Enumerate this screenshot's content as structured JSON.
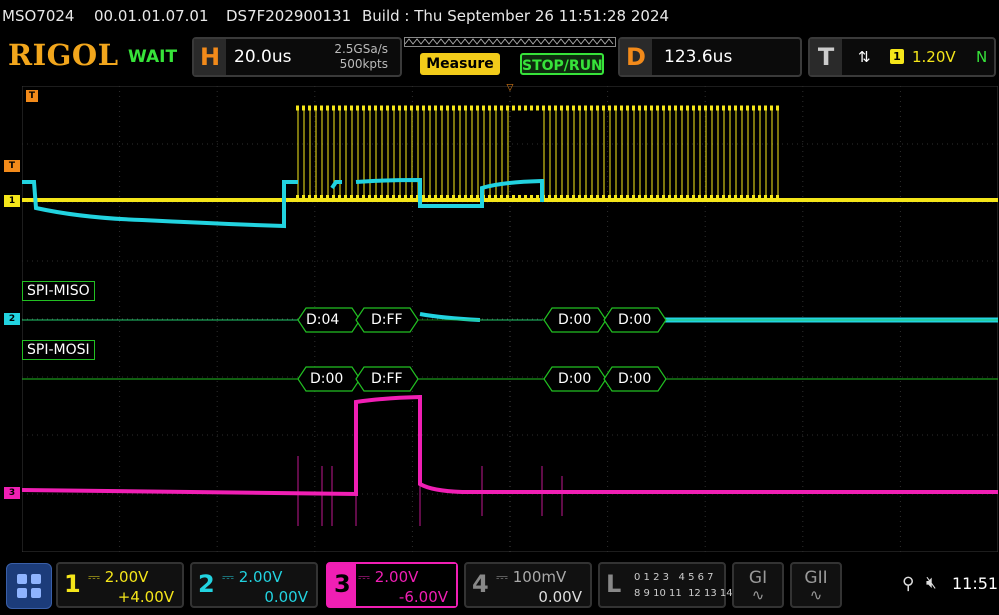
{
  "top_info": {
    "model": "MSO7024",
    "firmware": "00.01.01.07.01",
    "serial": "DS7F202900131",
    "build": "Build : Thu September 26 11:51:28 2024"
  },
  "toolbar": {
    "logo": "RIGOL",
    "status": "WAIT",
    "horizontal": {
      "badge": "H",
      "timebase": "20.0us",
      "sample_rate": "2.5GSa/s",
      "memory": "500kpts"
    },
    "measure_label": "Measure",
    "stop_run_label": "STOP/RUN",
    "delay": {
      "badge": "D",
      "value": "123.6us"
    },
    "trigger": {
      "badge": "T",
      "edge": "⇅",
      "source": "1",
      "level": "1.20V",
      "mode": "N"
    }
  },
  "markers": {
    "trigger_pos": "T",
    "trigger_level": "T",
    "ch1": "1",
    "ch2": "2",
    "ch3": "3"
  },
  "decoders": {
    "miso": {
      "label": "SPI-MISO",
      "packets": [
        "D:04",
        "D:FF",
        "D:00",
        "D:00"
      ]
    },
    "mosi": {
      "label": "SPI-MOSI",
      "packets": [
        "D:00",
        "D:FF",
        "D:00",
        "D:00"
      ]
    }
  },
  "channels": [
    {
      "num": "1",
      "scale": "2.00V",
      "offset": "+4.00V",
      "color": "#f5e61a"
    },
    {
      "num": "2",
      "scale": "2.00V",
      "offset": "0.00V",
      "color": "#22d3e0"
    },
    {
      "num": "3",
      "scale": "2.00V",
      "offset": "-6.00V",
      "color": "#f01fb4"
    },
    {
      "num": "4",
      "scale": "100mV",
      "offset": "0.00V",
      "color": "#777777"
    }
  ],
  "logic": {
    "badge": "L",
    "row1": "0 1 2 3   4 5 6 7",
    "row2": "8 9 10 11  12 13 14 15"
  },
  "gen": {
    "g1": "GI",
    "g2": "GII"
  },
  "system": {
    "time": "11:51",
    "usb_icon": "usb-icon",
    "sound_icon": "speaker-muted-icon"
  },
  "colors": {
    "ch1": "#f5e61a",
    "ch2": "#22d3e0",
    "ch3": "#f01fb4",
    "trigger": "#f28a1a",
    "grid": "#3a3a3a",
    "decode": "#22c022"
  }
}
